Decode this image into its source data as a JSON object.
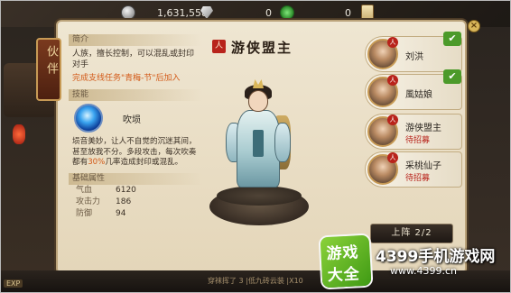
{
  "top_bar": {
    "coin_value": "1,631,558",
    "gem_value": "0",
    "jade_value": "0"
  },
  "banner": "伙伴",
  "info": {
    "intro_heading": "简介",
    "intro_text": "人族，擅长控制，可以混乱或封印对手",
    "unlock_text": "完成支线任务\"青梅-节\"后加入",
    "skill_heading": "技能",
    "skill_name": "吹埙",
    "skill_desc_a": "埙音美妙，让人不自觉的沉迷其间，甚至放我不分。多段攻击，每次吹奏都有",
    "skill_desc_hl": "30%",
    "skill_desc_b": "几率造成封印或混乱。",
    "stats_heading": "基础属性",
    "stats": [
      {
        "label": "气血",
        "value": "6120"
      },
      {
        "label": "攻击力",
        "value": "186"
      },
      {
        "label": "防御",
        "value": "94"
      }
    ]
  },
  "hero": {
    "title_seal": "人",
    "title": "游侠盟主"
  },
  "roster": [
    {
      "badge": "人",
      "name": "刘洪",
      "status": "",
      "checked": true
    },
    {
      "badge": "人",
      "name": "風姑娘",
      "status": "",
      "checked": true
    },
    {
      "badge": "人",
      "name": "游侠盟主",
      "status": "待招募",
      "checked": false
    },
    {
      "badge": "人",
      "name": "采桃仙子",
      "status": "待招募",
      "checked": false
    }
  ],
  "deploy_button": "上阵 2/2",
  "close_label": "×",
  "bottom": {
    "message": "穿袜挥了 3 |低九砖云装 |X10",
    "exp_label": "EXP"
  },
  "watermark": {
    "badge_line1": "游戏",
    "badge_line2": "大全",
    "site_name": "4399手机游戏网",
    "site_url": "www.4399.cn"
  },
  "colors": {
    "panel_bg": "#efe6d2",
    "accent_red": "#b8231b",
    "highlight_orange": "#d35a18",
    "check_green": "#4c9a2a"
  }
}
